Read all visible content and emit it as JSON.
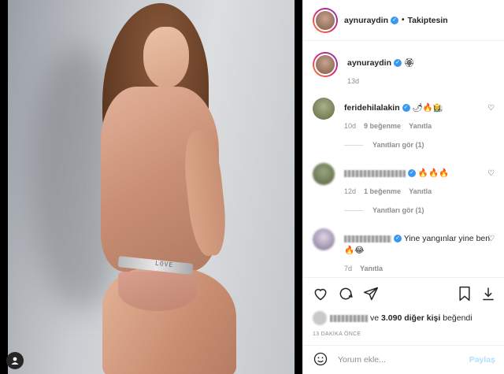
{
  "post": {
    "username": "aynuraydin",
    "follow_status": "Takiptesin",
    "caption_emoji": "🏵",
    "caption_age": "13d",
    "belt_text": "LOVE"
  },
  "comments": [
    {
      "user": "feridehilalakin",
      "text": "🌶🔥👩‍🌾",
      "age": "10d",
      "likes": "9 beğenme",
      "reply": "Yanıtla",
      "replies": "Yanıtları gör (1)"
    },
    {
      "user": "",
      "text": "🔥🔥🔥",
      "age": "12d",
      "likes": "1 beğenme",
      "reply": "Yanıtla",
      "replies": "Yanıtları gör (1)"
    },
    {
      "user": "",
      "text": "Yine yangınlar yine ben🔥😂",
      "age": "7d",
      "reply": "Yanıtla"
    }
  ],
  "likes": {
    "prefix": "ve",
    "count": "3.090 diğer kişi",
    "suffix": "beğendi"
  },
  "timestamp": "13 DAKİKA ÖNCE",
  "add_comment": {
    "placeholder": "Yorum ekle...",
    "post_label": "Paylaş"
  },
  "icons": [
    "heart-icon",
    "comment-icon",
    "share-icon",
    "bookmark-icon",
    "download-icon",
    "emoji-icon",
    "more-icon"
  ],
  "colors": {
    "verified": "#3897f0",
    "post_disabled": "#b2dffc",
    "meta_gray": "#8e8e8e"
  }
}
